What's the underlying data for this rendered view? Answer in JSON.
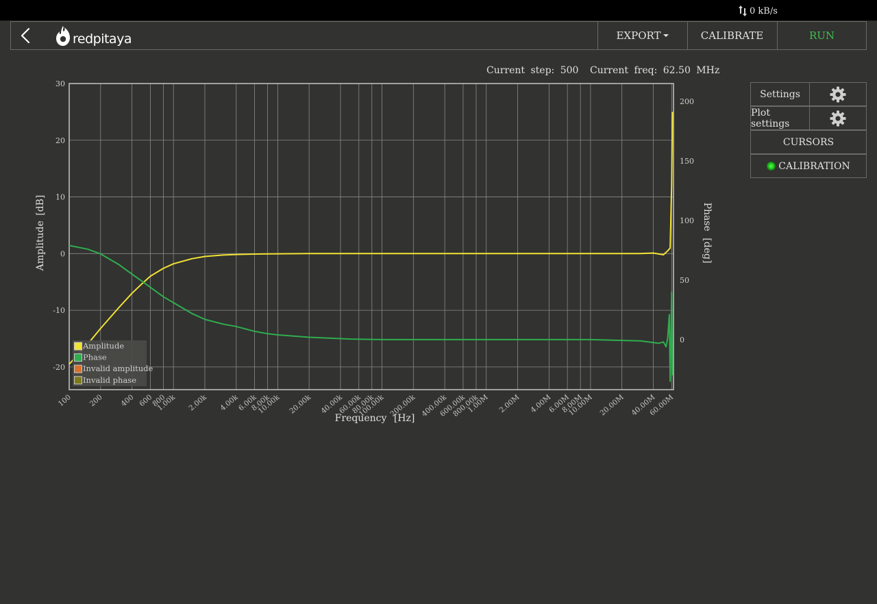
{
  "topbar": {
    "net_rate": "0 kB/s",
    "net_icon": "transfer-arrows-icon"
  },
  "header": {
    "back_icon": "back-chevron-icon",
    "logo_text": "redpitaya",
    "export_label": "EXPORT",
    "calibrate_label": "CALIBRATE",
    "run_label": "RUN"
  },
  "status": {
    "step_text": "Current step: 500",
    "freq_text": "Current freq: 62.50 MHz"
  },
  "sidebar": {
    "settings_label": "Settings",
    "plot_settings_label": "Plot settings",
    "cursors_label": "CURSORS",
    "calibration_label": "CALIBRATION",
    "gear_icon": "gear-icon",
    "calibration_led_color": "#22cc22"
  },
  "chart_data": {
    "type": "line",
    "xlabel": "Frequency [Hz]",
    "ylabel": "Amplitude [dB]",
    "y2label": "Phase [deg]",
    "xscale": "log",
    "xlim": [
      100,
      62500000
    ],
    "ylim": [
      -24,
      30
    ],
    "y2lim": [
      -42,
      215
    ],
    "yticks": [
      30,
      20,
      10,
      0,
      -10,
      -20
    ],
    "y2ticks": [
      200,
      150,
      100,
      50,
      0
    ],
    "xticks": [
      {
        "v": 100,
        "l": "100"
      },
      {
        "v": 200,
        "l": "200"
      },
      {
        "v": 400,
        "l": "400"
      },
      {
        "v": 600,
        "l": "600"
      },
      {
        "v": 800,
        "l": "800"
      },
      {
        "v": 1000,
        "l": "1.00k"
      },
      {
        "v": 2000,
        "l": "2.00k"
      },
      {
        "v": 4000,
        "l": "4.00k"
      },
      {
        "v": 6000,
        "l": "6.00k"
      },
      {
        "v": 8000,
        "l": "8.00k"
      },
      {
        "v": 10000,
        "l": "10.00k"
      },
      {
        "v": 20000,
        "l": "20.00k"
      },
      {
        "v": 40000,
        "l": "40.00k"
      },
      {
        "v": 60000,
        "l": "60.00k"
      },
      {
        "v": 80000,
        "l": "80.00k"
      },
      {
        "v": 100000,
        "l": "100.00k"
      },
      {
        "v": 200000,
        "l": "200.00k"
      },
      {
        "v": 400000,
        "l": "400.00k"
      },
      {
        "v": 600000,
        "l": "600.00k"
      },
      {
        "v": 800000,
        "l": "800.00k"
      },
      {
        "v": 1000000,
        "l": "1.00M"
      },
      {
        "v": 2000000,
        "l": "2.00M"
      },
      {
        "v": 4000000,
        "l": "4.00M"
      },
      {
        "v": 6000000,
        "l": "6.00M"
      },
      {
        "v": 8000000,
        "l": "8.00M"
      },
      {
        "v": 10000000,
        "l": "10.00M"
      },
      {
        "v": 20000000,
        "l": "20.00M"
      },
      {
        "v": 40000000,
        "l": "40.00M"
      },
      {
        "v": 60000000,
        "l": "60.00M"
      }
    ],
    "grid": true,
    "legend_position": "bottom-left",
    "legend": [
      {
        "name": "Amplitude",
        "color": "#f2e234"
      },
      {
        "name": "Phase",
        "color": "#2fae4e"
      },
      {
        "name": "Invalid amplitude",
        "color": "#d9702b"
      },
      {
        "name": "Invalid phase",
        "color": "#7d7a1c"
      }
    ],
    "series": [
      {
        "name": "Amplitude",
        "axis": "left",
        "color": "#f2e234",
        "x": [
          100,
          150,
          200,
          300,
          400,
          500,
          600,
          800,
          1000,
          1500,
          2000,
          3000,
          4000,
          6000,
          10000,
          20000,
          50000,
          100000,
          1000000,
          10000000,
          30000000,
          40000000,
          50000000,
          55000000,
          58000000,
          60000000,
          61000000
        ],
        "y": [
          -19.5,
          -16.0,
          -13.2,
          -9.5,
          -7.0,
          -5.3,
          -4.0,
          -2.6,
          -1.8,
          -0.9,
          -0.5,
          -0.25,
          -0.15,
          -0.08,
          -0.03,
          0.0,
          0.0,
          0.0,
          0.0,
          0.0,
          0.0,
          0.1,
          -0.2,
          0.5,
          1.0,
          12.0,
          25.0
        ]
      },
      {
        "name": "Phase",
        "axis": "right",
        "color": "#2fae4e",
        "x": [
          100,
          150,
          200,
          300,
          400,
          500,
          600,
          800,
          1000,
          1500,
          2000,
          3000,
          4000,
          6000,
          8000,
          10000,
          20000,
          50000,
          100000,
          1000000,
          10000000,
          30000000,
          45000000,
          50000000,
          53000000,
          55000000,
          57000000,
          58000000,
          59000000,
          60000000,
          61000000
        ],
        "y": [
          79,
          76,
          72,
          63,
          55,
          49,
          44,
          36,
          31,
          22,
          17,
          13,
          11,
          7,
          5,
          4,
          2,
          0.5,
          0,
          0,
          0,
          -1,
          -3,
          -2,
          -6,
          2,
          21,
          -35,
          -5,
          40,
          -30
        ]
      }
    ]
  }
}
